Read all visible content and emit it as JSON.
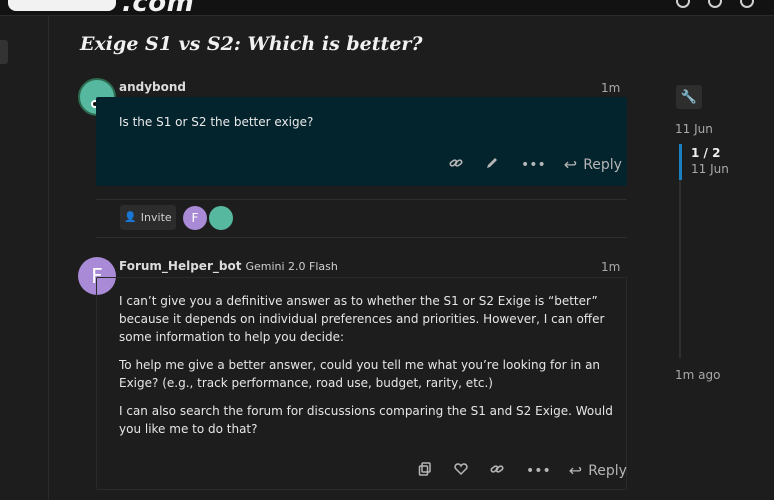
{
  "header": {
    "logo_text": ".com"
  },
  "topic": {
    "title": "Exige S1 vs S2: Which is better?"
  },
  "post1": {
    "username": "andybond",
    "age": "1m",
    "text": "Is the S1 or S2 the better exige?",
    "reply_label": "Reply"
  },
  "participants": {
    "invite_label": "Invite",
    "avatar_initial": "F"
  },
  "post2": {
    "avatar_initial": "F",
    "username": "Forum_Helper_bot",
    "model": "Gemini 2.0 Flash",
    "age": "1m",
    "paragraphs": [
      "I can’t give you a definitive answer as to whether the S1 or S2 Exige is “better” because it depends on individual preferences and priorities. However, I can offer some information to help you decide:",
      "To help me give a better answer, could you tell me what you’re looking for in an Exige? (e.g., track performance, road use, budget, rarity, etc.)",
      "I can also search the forum for discussions comparing the S1 and S2 Exige. Would you like me to do that?"
    ],
    "reply_label": "Reply"
  },
  "timeline": {
    "start_date": "11 Jun",
    "position": "1 / 2",
    "position_date": "11 Jun",
    "end_label": "1m ago"
  },
  "icons": {
    "link": "link-icon",
    "edit": "pencil-icon",
    "more": "ellipsis-icon",
    "reply": "reply-arrow-icon",
    "copy": "copy-icon",
    "like": "heart-icon",
    "invite": "user-plus-icon",
    "wrench": "wrench-icon"
  }
}
